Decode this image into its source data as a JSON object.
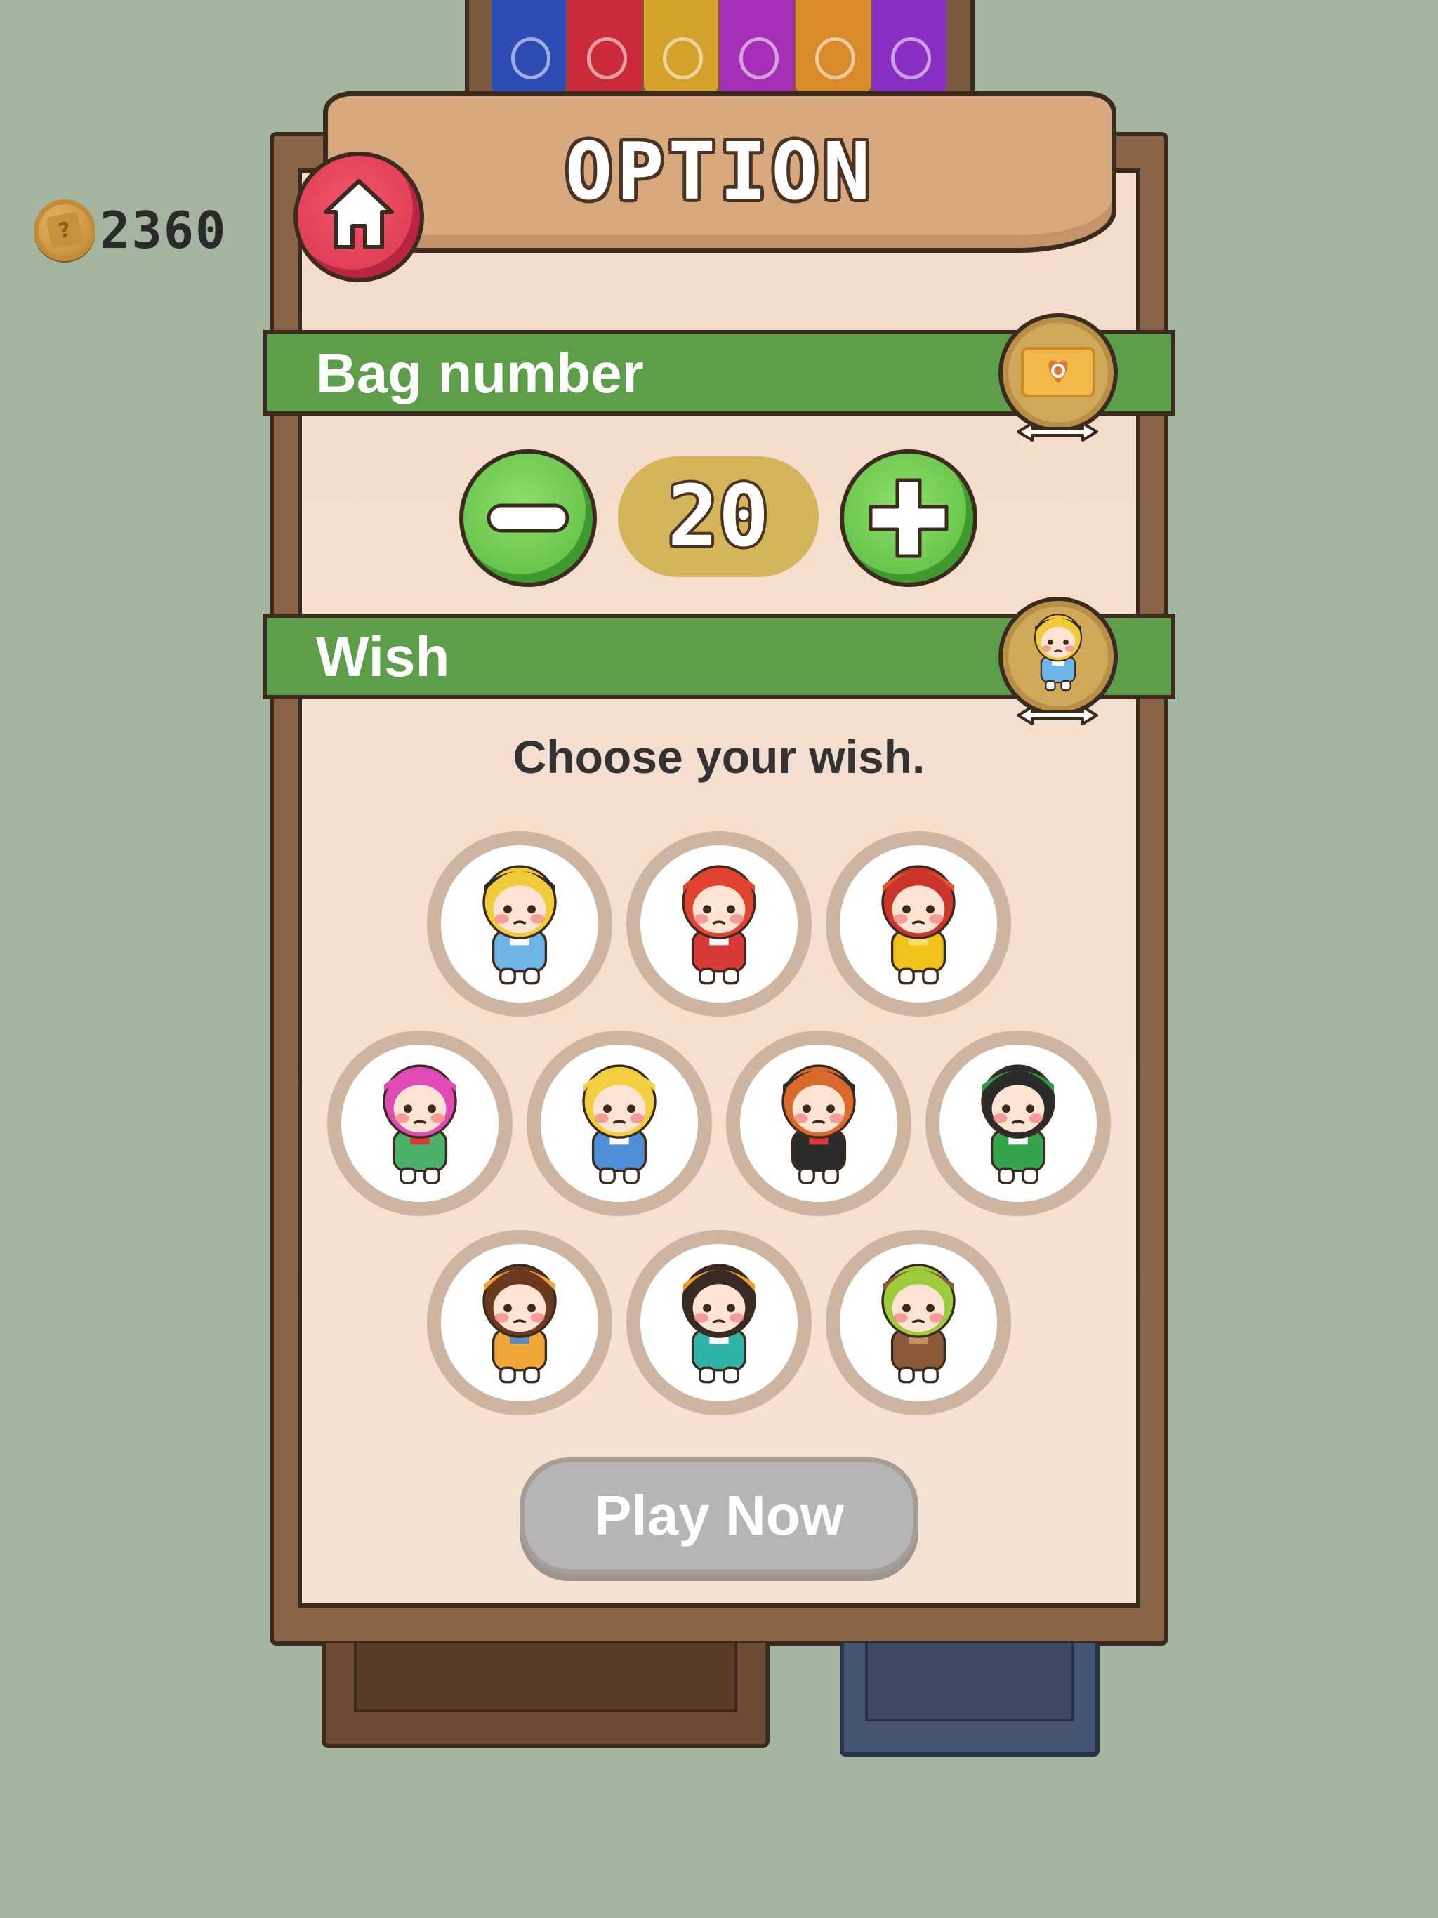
{
  "coins": {
    "count": "2360"
  },
  "title": "OPTION",
  "bag_number": {
    "label": "Bag number",
    "value": "20"
  },
  "wish": {
    "label": "Wish",
    "prompt": "Choose your wish.",
    "selected_index": 0,
    "options": [
      {
        "id": "doll-bee-blonde",
        "hair": "#f0cc3a",
        "hat": "#2b2b2b",
        "outfit": "#6fb6e8",
        "accent": "#ffffff"
      },
      {
        "id": "doll-red-stripes",
        "hair": "#e0432f",
        "hat": "#e0432f",
        "outfit": "#d83a3a",
        "accent": "#ffffff"
      },
      {
        "id": "doll-red-hood-yellow",
        "hair": "#c9352a",
        "hat": "#e2552c",
        "outfit": "#f0c21c",
        "accent": "#f7dc6f"
      },
      {
        "id": "doll-pink-green",
        "hair": "#e04ab4",
        "hat": "#e04ab4",
        "outfit": "#4bb06a",
        "accent": "#d83a3a"
      },
      {
        "id": "doll-blonde-blue",
        "hair": "#f2cf3e",
        "hat": "#f2cf3e",
        "outfit": "#4e8fd8",
        "accent": "#ffffff"
      },
      {
        "id": "doll-bear-red-black",
        "hair": "#d96a2c",
        "hat": "#2b2b2b",
        "outfit": "#2b2b2b",
        "accent": "#d83a3a"
      },
      {
        "id": "doll-frog-green",
        "hair": "#2b2b2b",
        "hat": "#2f9a46",
        "outfit": "#33a54d",
        "accent": "#ffffff"
      },
      {
        "id": "doll-bee-orange",
        "hair": "#6b3a1e",
        "hat": "#f1a638",
        "outfit": "#f1a638",
        "accent": "#5a89c8"
      },
      {
        "id": "doll-teal-pumpkin",
        "hair": "#3a2a24",
        "hat": "#f29a2a",
        "outfit": "#2fb3a8",
        "accent": "#ffffff"
      },
      {
        "id": "doll-bear-brown",
        "hair": "#9ccc3c",
        "hat": "#8a5a3a",
        "outfit": "#8a5a3a",
        "accent": "#c98f5e"
      }
    ]
  },
  "shelf_bags": [
    "#2f4bb5",
    "#c92b3a",
    "#d4a12b",
    "#a62fb8",
    "#d98a2a",
    "#8a2fc4"
  ],
  "play_button": {
    "label": "Play Now"
  },
  "colors": {
    "background": "#a4b6a0",
    "section_green": "#5c9e4a",
    "home_red": "#e8445d",
    "stepper_green": "#6ccc4e",
    "value_gold": "#d4b55c"
  }
}
